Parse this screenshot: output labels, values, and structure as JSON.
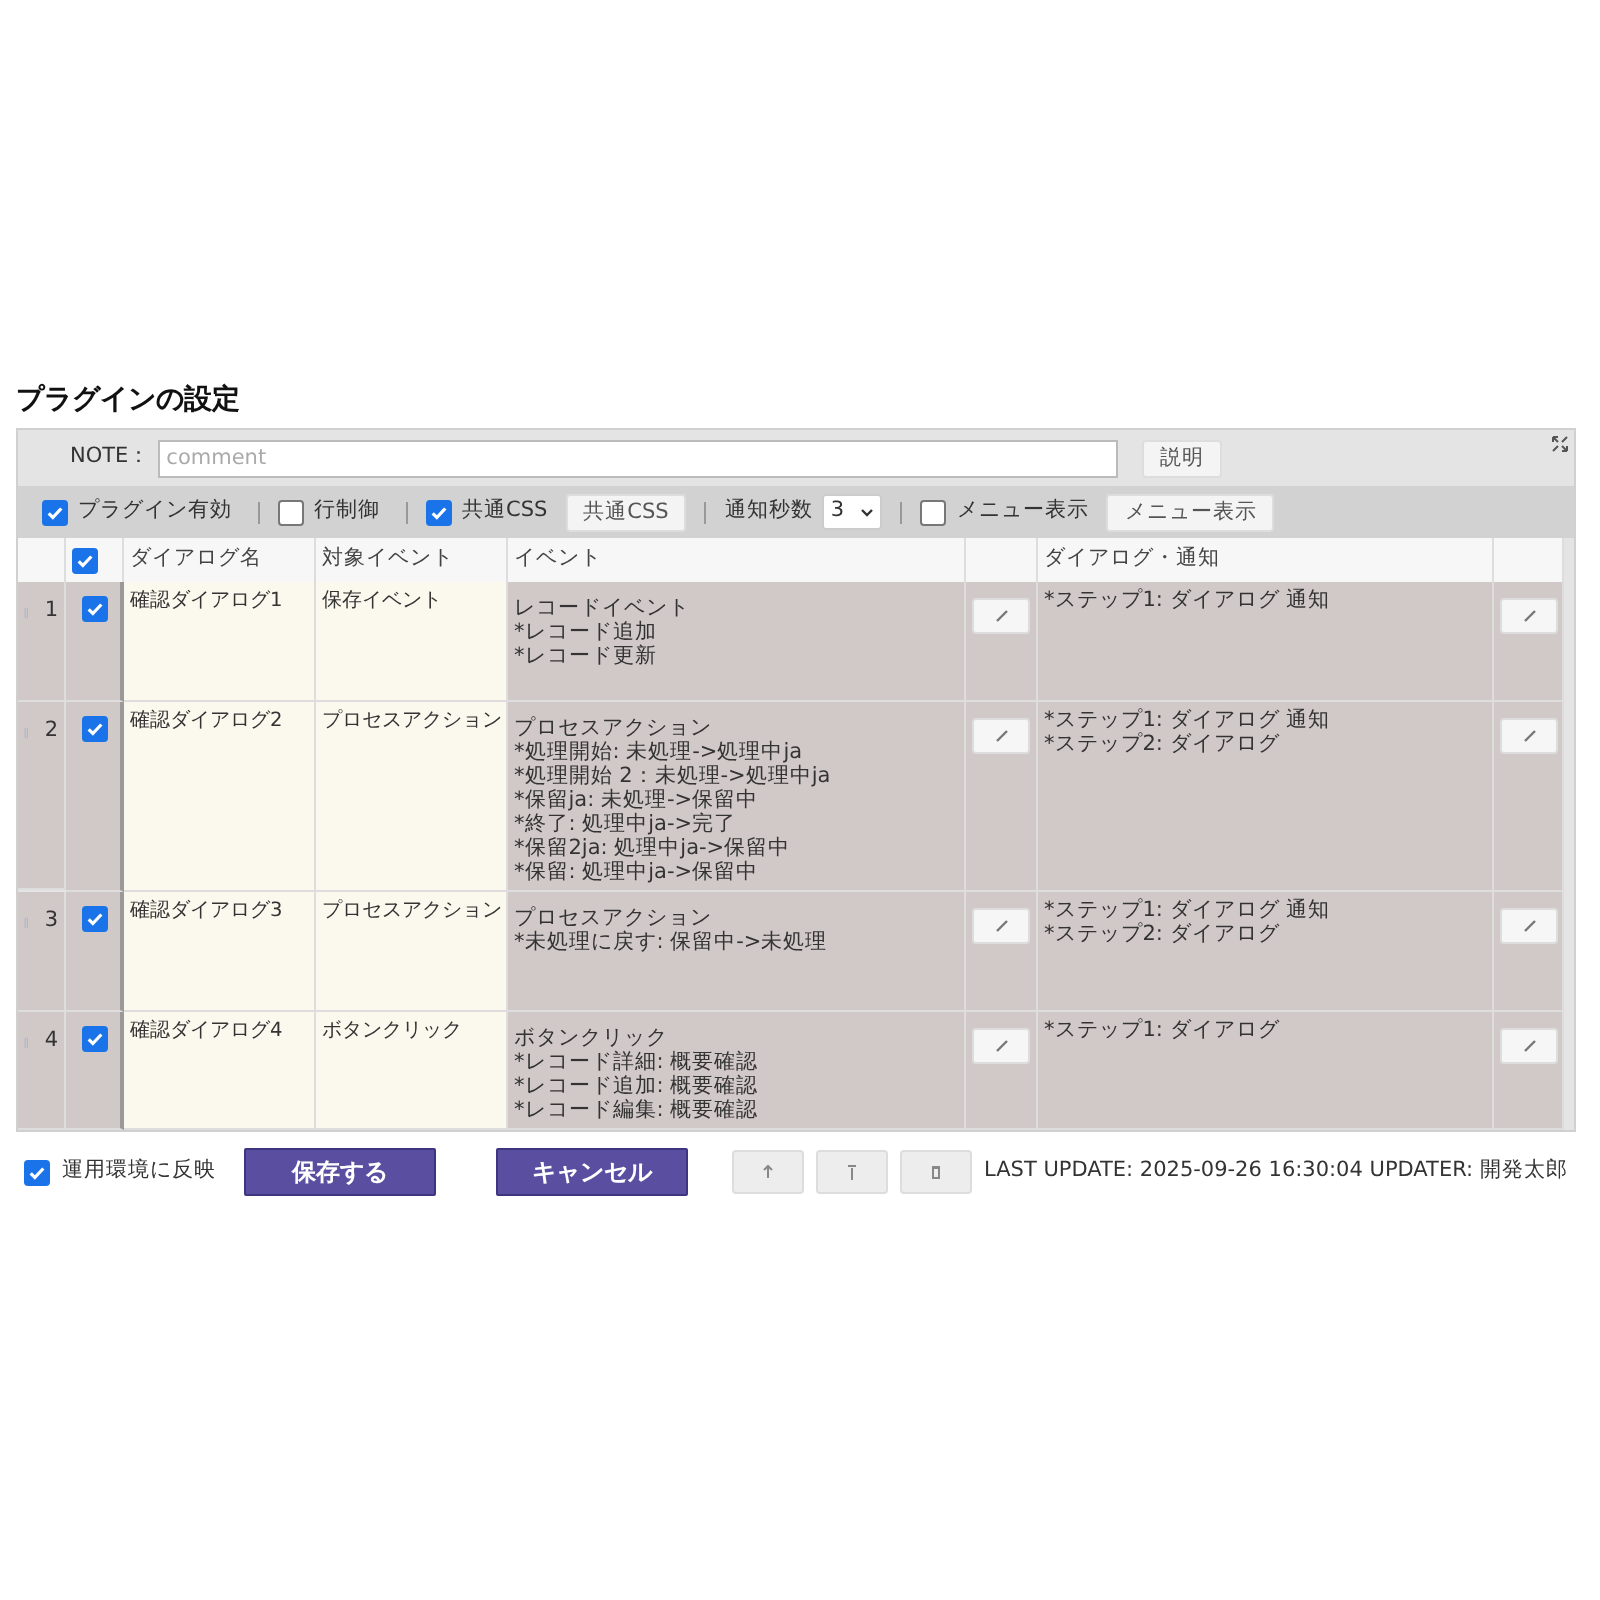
{
  "title": "プラグインの設定",
  "note": {
    "label": "NOTE：",
    "placeholder": "comment",
    "button": "説明"
  },
  "toolbar": [
    {
      "kind": "checkbox",
      "label": "プラグイン有効",
      "checked": true
    },
    {
      "kind": "separator"
    },
    {
      "kind": "checkbox",
      "label": "行制御",
      "checked": false
    },
    {
      "kind": "separator"
    },
    {
      "kind": "checkbox",
      "label": "共通CSS",
      "checked": true
    },
    {
      "kind": "button",
      "label": "共通CSS"
    },
    {
      "kind": "separator"
    },
    {
      "kind": "select",
      "label": "通知秒数",
      "value": "3"
    },
    {
      "kind": "separator"
    },
    {
      "kind": "checkbox",
      "label": "メニュー表示",
      "checked": false
    },
    {
      "kind": "button",
      "label": "メニュー表示"
    }
  ],
  "table": {
    "header_checked": true,
    "columns": [
      "ダイアログ名",
      "対象イベント",
      "イベント",
      "ダイアログ・通知"
    ],
    "rows": [
      {
        "number": "1",
        "checked": true,
        "name": "確認ダイアログ1",
        "target": "保存イベント",
        "event": [
          "レコードイベント",
          "*レコード追加",
          "*レコード更新"
        ],
        "dialog": [
          "*ステップ1: ダイアログ 通知"
        ]
      },
      {
        "number": "2",
        "checked": true,
        "name": "確認ダイアログ2",
        "target": "プロセスアクション",
        "event": [
          "プロセスアクション",
          "*処理開始: 未処理->処理中ja",
          "*処理開始 2：未処理->処理中ja",
          "*保留ja: 未処理->保留中",
          "*終了: 処理中ja->完了",
          "*保留2ja: 処理中ja->保留中",
          "*保留: 処理中ja->保留中"
        ],
        "dialog": [
          "*ステップ1: ダイアログ 通知",
          "*ステップ2: ダイアログ"
        ]
      },
      {
        "number": "3",
        "checked": true,
        "name": "確認ダイアログ3",
        "target": "プロセスアクション",
        "event": [
          "プロセスアクション",
          "*未処理に戻す: 保留中->未処理"
        ],
        "dialog": [
          "*ステップ1: ダイアログ 通知",
          "*ステップ2: ダイアログ"
        ]
      },
      {
        "number": "4",
        "checked": true,
        "name": "確認ダイアログ4",
        "target": "ボタンクリック",
        "event": [
          "ボタンクリック",
          "*レコード詳細: 概要確認",
          "*レコード追加: 概要確認",
          "*レコード編集: 概要確認"
        ],
        "dialog": [
          "*ステップ1: ダイアログ"
        ]
      }
    ]
  },
  "footer": {
    "reflect_label": "運用環境に反映",
    "reflect_checked": true,
    "save": "保存する",
    "cancel": "キャンセル",
    "last_update": "LAST UPDATE: 2025-09-26 16:30:04 UPDATER: 開発太郎"
  }
}
